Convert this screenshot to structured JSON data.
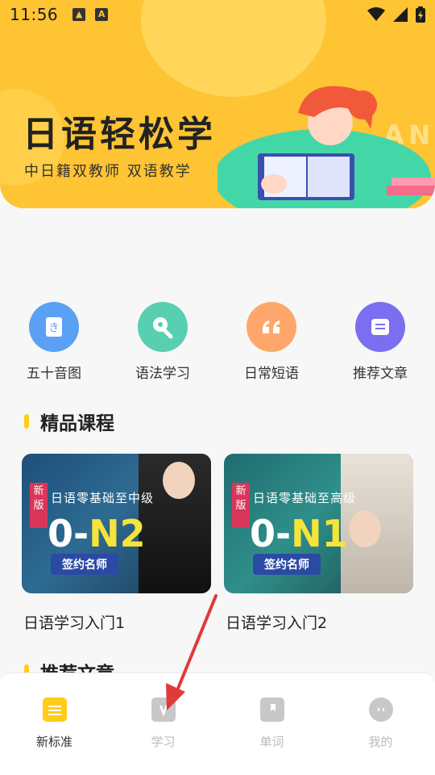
{
  "status_bar": {
    "time": "11:56"
  },
  "banner": {
    "title": "日语轻松学",
    "subtitle": "中日籍双教师 双语教学",
    "bg_text": "AN",
    "color": "#ffc433"
  },
  "quick_links": [
    {
      "label": "五十音图",
      "icon": "hiragana-card-icon",
      "color": "#5aa1f5"
    },
    {
      "label": "语法学习",
      "icon": "pen-nib-icon",
      "color": "#57cfb0"
    },
    {
      "label": "日常短语",
      "icon": "quote-icon",
      "color": "#ffa76a"
    },
    {
      "label": "推荐文章",
      "icon": "article-icon",
      "color": "#7b6ef0"
    }
  ],
  "sections": {
    "premium": "精品课程",
    "recommended": "推荐文章"
  },
  "courses": [
    {
      "title": "日语学习入门1",
      "badge": "新版",
      "caption": "日语零基础至中级",
      "level_prefix": "0-",
      "level": "N2",
      "sign": "签约名师"
    },
    {
      "title": "日语学习入门2",
      "badge": "新版",
      "caption": "日语零基础至高级",
      "level_prefix": "0-",
      "level": "N1",
      "sign": "签约名师"
    }
  ],
  "bottom_nav": [
    {
      "label": "新标准",
      "icon": "book-stack-icon",
      "active": true
    },
    {
      "label": "学习",
      "icon": "study-icon",
      "active": false
    },
    {
      "label": "单词",
      "icon": "bookmark-book-icon",
      "active": false
    },
    {
      "label": "我的",
      "icon": "profile-face-icon",
      "active": false
    }
  ],
  "colors": {
    "accent": "#ffcc1a",
    "annotation_arrow": "#e03a3a"
  }
}
